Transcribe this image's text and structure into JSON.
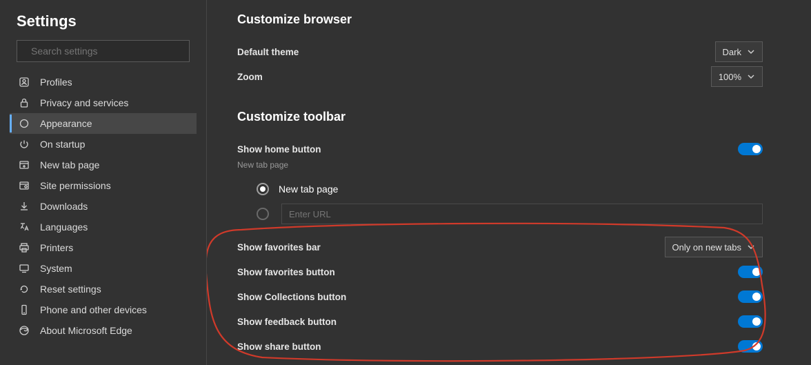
{
  "sidebar": {
    "title": "Settings",
    "search_placeholder": "Search settings",
    "items": [
      {
        "label": "Profiles"
      },
      {
        "label": "Privacy and services"
      },
      {
        "label": "Appearance"
      },
      {
        "label": "On startup"
      },
      {
        "label": "New tab page"
      },
      {
        "label": "Site permissions"
      },
      {
        "label": "Downloads"
      },
      {
        "label": "Languages"
      },
      {
        "label": "Printers"
      },
      {
        "label": "System"
      },
      {
        "label": "Reset settings"
      },
      {
        "label": "Phone and other devices"
      },
      {
        "label": "About Microsoft Edge"
      }
    ],
    "active_index": 2
  },
  "main": {
    "browser_section_title": "Customize browser",
    "default_theme_label": "Default theme",
    "default_theme_value": "Dark",
    "zoom_label": "Zoom",
    "zoom_value": "100%",
    "toolbar_section_title": "Customize toolbar",
    "home_button_label": "Show home button",
    "home_button_note": "New tab page",
    "home_radio_newtab": "New tab page",
    "home_url_placeholder": "Enter URL",
    "fav_bar_label": "Show favorites bar",
    "fav_bar_value": "Only on new tabs",
    "fav_button_label": "Show favorites button",
    "collections_label": "Show Collections button",
    "feedback_label": "Show feedback button",
    "share_label": "Show share button"
  },
  "colors": {
    "accent": "#0078d4",
    "annotation": "#d03a2a"
  }
}
